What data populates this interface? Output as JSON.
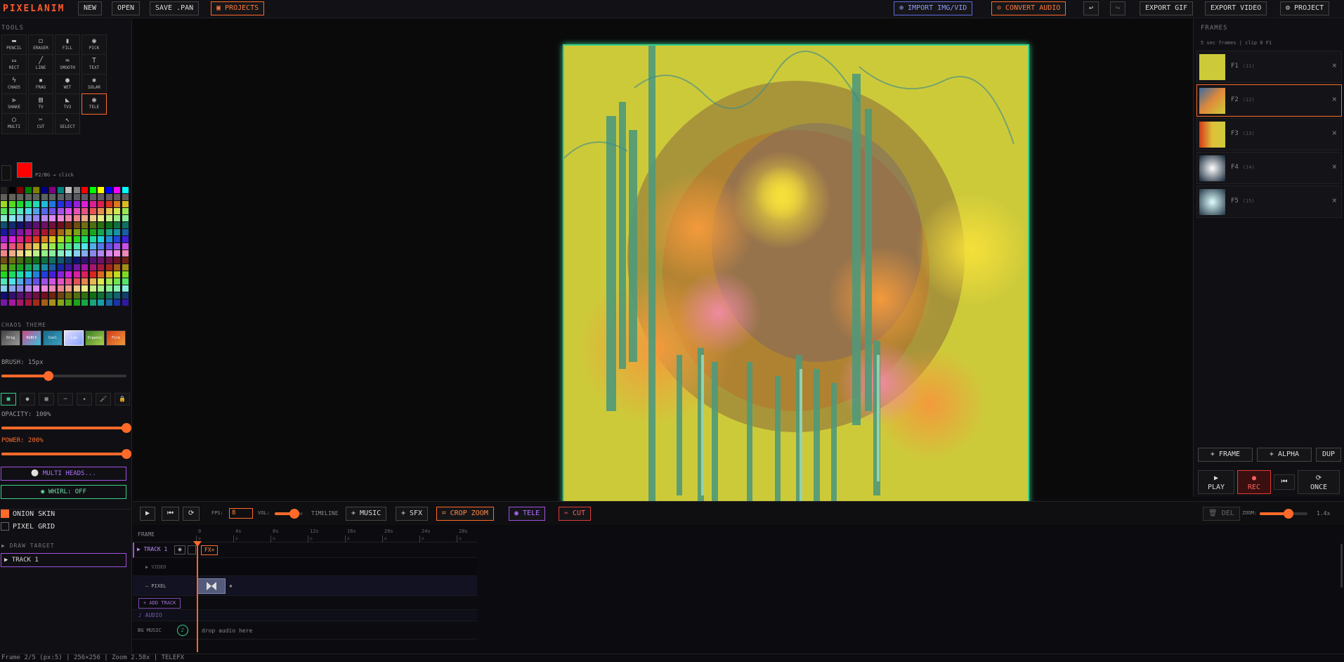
{
  "app": {
    "logo": "PIXELANIM"
  },
  "topbar": {
    "new": "NEW",
    "open": "OPEN",
    "save": "SAVE .PAN",
    "projects": "▣ PROJECTS",
    "import": "⊕ IMPORT IMG/VID",
    "convert_audio": "⊙ CONVERT AUDIO",
    "undo": "↩",
    "redo": "↪",
    "export_gif": "EXPORT GIF",
    "export_video": "EXPORT VIDEO",
    "project": "⚙ PROJECT"
  },
  "tools": {
    "heading": "TOOLS",
    "items": [
      {
        "label": "PENCIL",
        "icon": "▬"
      },
      {
        "label": "ERASER",
        "icon": "◻"
      },
      {
        "label": "FILL",
        "icon": "▮"
      },
      {
        "label": "PICK",
        "icon": "◉"
      },
      {
        "label": "RECT",
        "icon": "▭"
      },
      {
        "label": "LINE",
        "icon": "╱"
      },
      {
        "label": "SMOOTH",
        "icon": "≈"
      },
      {
        "label": "TEXT",
        "icon": "T"
      },
      {
        "label": "CHAOS",
        "icon": "ϟ"
      },
      {
        "label": "FRAG",
        "icon": "▪"
      },
      {
        "label": "WET",
        "icon": "●"
      },
      {
        "label": "SOLAR",
        "icon": "✱"
      },
      {
        "label": "SHAKE",
        "icon": "⫸"
      },
      {
        "label": "TV",
        "icon": "▤"
      },
      {
        "label": "TV3",
        "icon": "◣"
      },
      {
        "label": "TELE",
        "icon": "◉"
      },
      {
        "label": "MULTI",
        "icon": "○"
      },
      {
        "label": "CUT",
        "icon": "✂"
      },
      {
        "label": "SELECT",
        "icon": "↖"
      }
    ]
  },
  "colors": {
    "hint": "P2/BG → click",
    "fg": "#ff0000",
    "bg": "#111111",
    "accent": "#ff6a2a",
    "canvas_border": "#3ad08a"
  },
  "chaos_theme": {
    "heading": "CHAOS THEME",
    "items": [
      "Orig",
      "RGBCh",
      "Cool",
      "Lum",
      "Organic",
      "Fire"
    ]
  },
  "brush": {
    "label": "BRUSH: 15px",
    "value": 15,
    "max": 40,
    "shapes": [
      "■",
      "●",
      "▦",
      "─",
      "✦",
      "🖌",
      "🔒"
    ]
  },
  "opacity": {
    "label": "OPACITY: 100%",
    "value": 1.0
  },
  "power": {
    "label": "POWER: 200%",
    "value": 1.0
  },
  "multi_heads": "⚪ MULTI HEADS...",
  "whirl": "◉ WHIRL: OFF",
  "onion_skin": "ONION SKIN",
  "pixel_grid": "PIXEL GRID",
  "draw_target": {
    "heading": "▶ DRAW TARGET",
    "value": "▶ TRACK 1"
  },
  "frames": {
    "heading": "FRAMES",
    "info": "5 sec frames | clip 8 F1",
    "items": [
      {
        "label": "F1",
        "sub": "(11)"
      },
      {
        "label": "F2",
        "sub": "(12)"
      },
      {
        "label": "F3",
        "sub": "(13)"
      },
      {
        "label": "F4",
        "sub": "(14)"
      },
      {
        "label": "F5",
        "sub": "(15)"
      }
    ],
    "add_frame": "+ FRAME",
    "add_alpha": "+ ALPHA",
    "dup": "DUP",
    "play": "PLAY",
    "rec": "REC",
    "first": "⏮",
    "once": "ONCE",
    "play_icon": "▶",
    "rec_icon": "●",
    "once_icon": "⟳"
  },
  "controls": {
    "play": "▶",
    "rewind": "⏮",
    "loop": "⟳",
    "fps_label": "FPS:",
    "fps": "8",
    "vol_label": "VOL:",
    "vol": 0.7,
    "timeline": "TIMELINE",
    "music": "+ MUSIC",
    "sfx": "+ SFX",
    "crop_zoom": "⌗ CROP ZOOM",
    "tele": "◉ TELE",
    "cut": "✂ CUT",
    "del": "🗑 DEL",
    "zoom_label": "ZOOM:",
    "zoom_value": "1.4x",
    "zoom": 0.6
  },
  "timeline": {
    "frame_label": "FRAME",
    "ticks": [
      "0",
      "4s",
      "8s",
      "12s",
      "16s",
      "20s",
      "24s",
      "28s"
    ],
    "track": "▶ TRACK 1",
    "fx": "FX+",
    "video": "▶ VIDEO",
    "pixel": "— PIXEL",
    "add_track": "+ ADD TRACK",
    "audio": "♪ AUDIO",
    "bg_music": "BG MUSIC",
    "drop_audio": "drop audio here"
  },
  "status": "Frame 2/5 (px:5) | 256×256 | Zoom 2.58x | TELEFX"
}
